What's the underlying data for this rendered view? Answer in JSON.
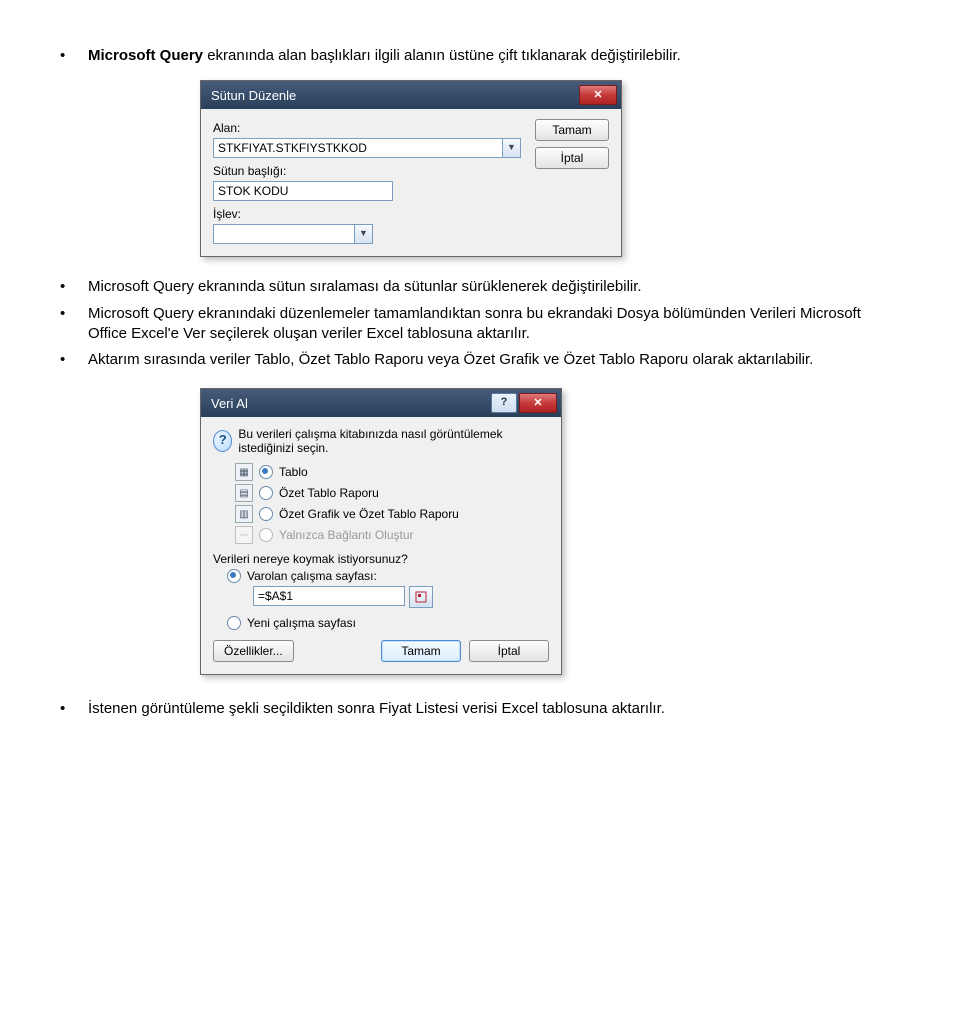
{
  "bullets": {
    "b1_bold": "Microsoft Query",
    "b1_rest": " ekranında alan başlıkları ilgili alanın üstüne çift tıklanarak değiştirilebilir.",
    "b2": "Microsoft Query ekranında sütun sıralaması da sütunlar sürüklenerek değiştirilebilir.",
    "b3": "Microsoft Query ekranındaki düzenlemeler tamamlandıktan sonra bu ekrandaki Dosya bölümünden Verileri Microsoft Office Excel'e Ver seçilerek oluşan veriler Excel tablosuna aktarılır.",
    "b4": "Aktarım sırasında veriler Tablo, Özet Tablo Raporu veya Özet Grafik ve Özet Tablo Raporu olarak aktarılabilir.",
    "b5": "İstenen görüntüleme şekli seçildikten sonra Fiyat Listesi verisi Excel tablosuna aktarılır."
  },
  "dlg1": {
    "title": "Sütun Düzenle",
    "labels": {
      "alan": "Alan:",
      "sutun_basligi": "Sütun başlığı:",
      "islev": "İşlev:"
    },
    "values": {
      "alan": "STKFIYAT.STKFIYSTKKOD",
      "sutun_basligi": "STOK KODU",
      "islev": ""
    },
    "buttons": {
      "ok": "Tamam",
      "cancel": "İptal"
    }
  },
  "dlg2": {
    "title": "Veri Al",
    "prompt": "Bu verileri çalışma kitabınızda nasıl görüntülemek istediğinizi seçin.",
    "options": {
      "tablo": "Tablo",
      "ozet_tablo": "Özet Tablo Raporu",
      "ozet_grafik": "Özet Grafik ve Özet Tablo Raporu",
      "yalnizca": "Yalnızca Bağlantı Oluştur"
    },
    "where_prompt": "Verileri nereye koymak istiyorsunuz?",
    "where": {
      "varolan": "Varolan çalışma sayfası:",
      "yeni": "Yeni çalışma sayfası",
      "ref": "=$A$1"
    },
    "buttons": {
      "props": "Özellikler...",
      "ok": "Tamam",
      "cancel": "İptal"
    },
    "help_glyph": "?"
  }
}
